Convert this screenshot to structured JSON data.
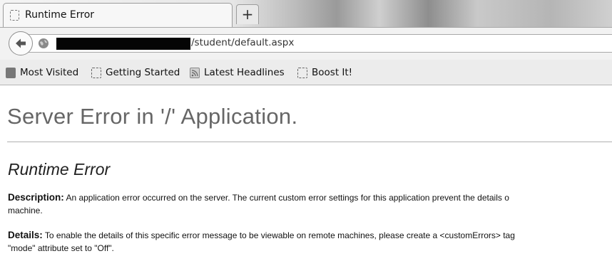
{
  "browser": {
    "tab": {
      "title": "Runtime Error",
      "favicon": "blank-page-icon"
    },
    "new_tab_label": "+",
    "address": {
      "visible_path": "/student/default.aspx",
      "redacted": true
    }
  },
  "bookmarks": [
    {
      "label": "Most Visited",
      "icon": "most-visited-icon"
    },
    {
      "label": "Getting Started",
      "icon": "blank-page-icon"
    },
    {
      "label": "Latest Headlines",
      "icon": "rss-feed-icon"
    },
    {
      "label": "Boost It!",
      "icon": "blank-page-icon"
    }
  ],
  "page": {
    "title": "Server Error in '/' Application.",
    "subtitle": "Runtime Error",
    "description_label": "Description:",
    "description_line1": " An application error occurred on the server. The current custom error settings for this application prevent the details o",
    "description_line2": "machine.",
    "details_label": "Details:",
    "details_line1": " To enable the details of this specific error message to be viewable on remote machines, please create a <customErrors> tag",
    "details_line2": "\"mode\" attribute set to \"Off\"."
  }
}
